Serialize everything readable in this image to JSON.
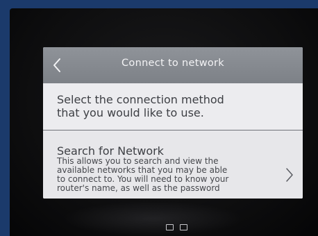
{
  "header": {
    "title": "Connect to network",
    "back_icon": "chevron-left-icon"
  },
  "instruction": {
    "line1": "Select the connection method",
    "line2": "that you would like to use."
  },
  "options": [
    {
      "title": "Search for Network",
      "description_lines": [
        "This allows you to search and view the",
        "available networks that you may be able",
        "to connect to. You will need to know your",
        "router's name, as well as the password"
      ],
      "icon": "chevron-right-icon"
    }
  ],
  "colors": {
    "header_bg": "#868a90",
    "screen_bg": "#e9e9ec",
    "text": "#3d3f44",
    "background": "#1b3a6b"
  }
}
